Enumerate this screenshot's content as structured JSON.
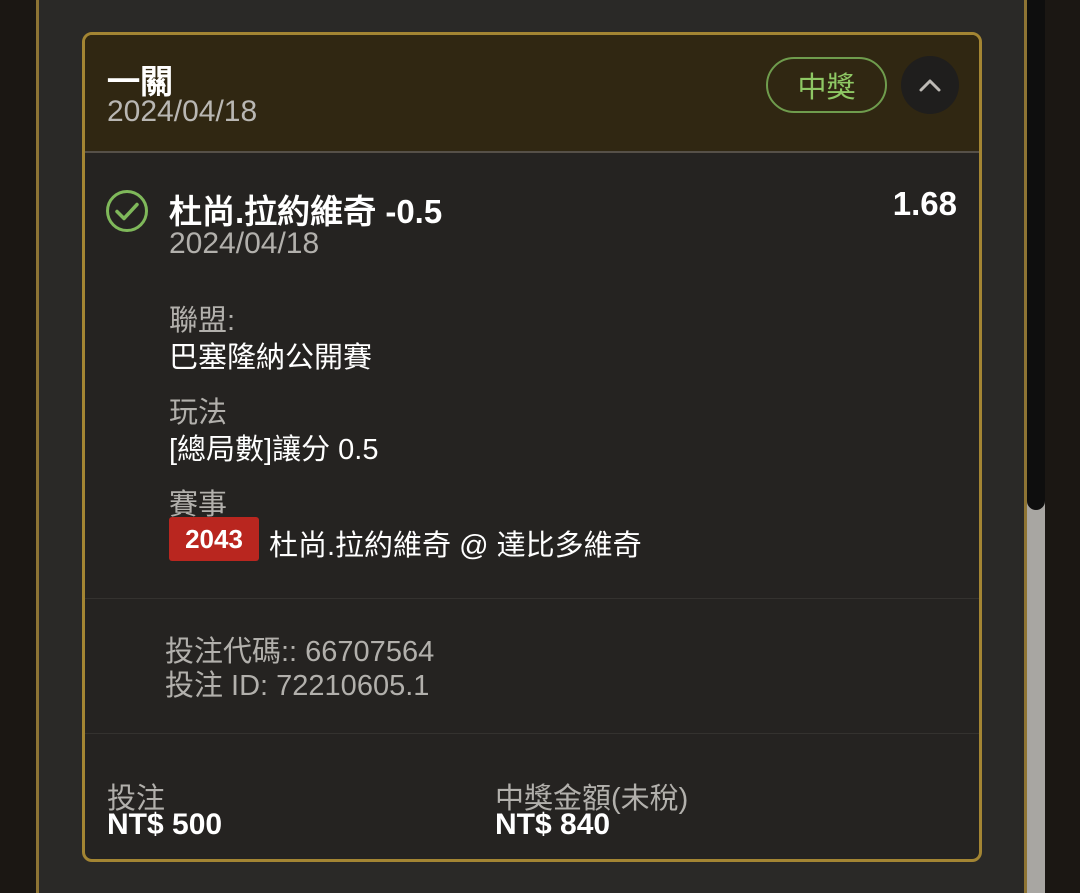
{
  "card": {
    "bet_type": "一關",
    "date": "2024/04/18",
    "status": "中獎",
    "selection": {
      "name": "杜尚.拉約維奇 -0.5",
      "date": "2024/04/18",
      "odds": "1.68",
      "league_label": "聯盟:",
      "league_value": "巴塞隆納公開賽",
      "market_label": "玩法",
      "market_value": "[總局數]讓分 0.5",
      "event_label": "賽事",
      "event_number": "2043",
      "event_teams": "杜尚.拉約維奇 @ 達比多維奇"
    },
    "bet_code": "投注代碼:: 66707564",
    "bet_id": "投注 ID: 72210605.1",
    "footer": {
      "stake_label": "投注",
      "stake_value": "NT$ 500",
      "payout_label": "中獎金額(未稅)",
      "payout_value": "NT$ 840"
    }
  },
  "icons": {
    "status": "check-circle-icon",
    "collapse": "chevron-up-icon"
  },
  "colors": {
    "accent_gold": "#a38533",
    "win_green": "#8ec864",
    "event_badge_red": "#b9261f"
  }
}
